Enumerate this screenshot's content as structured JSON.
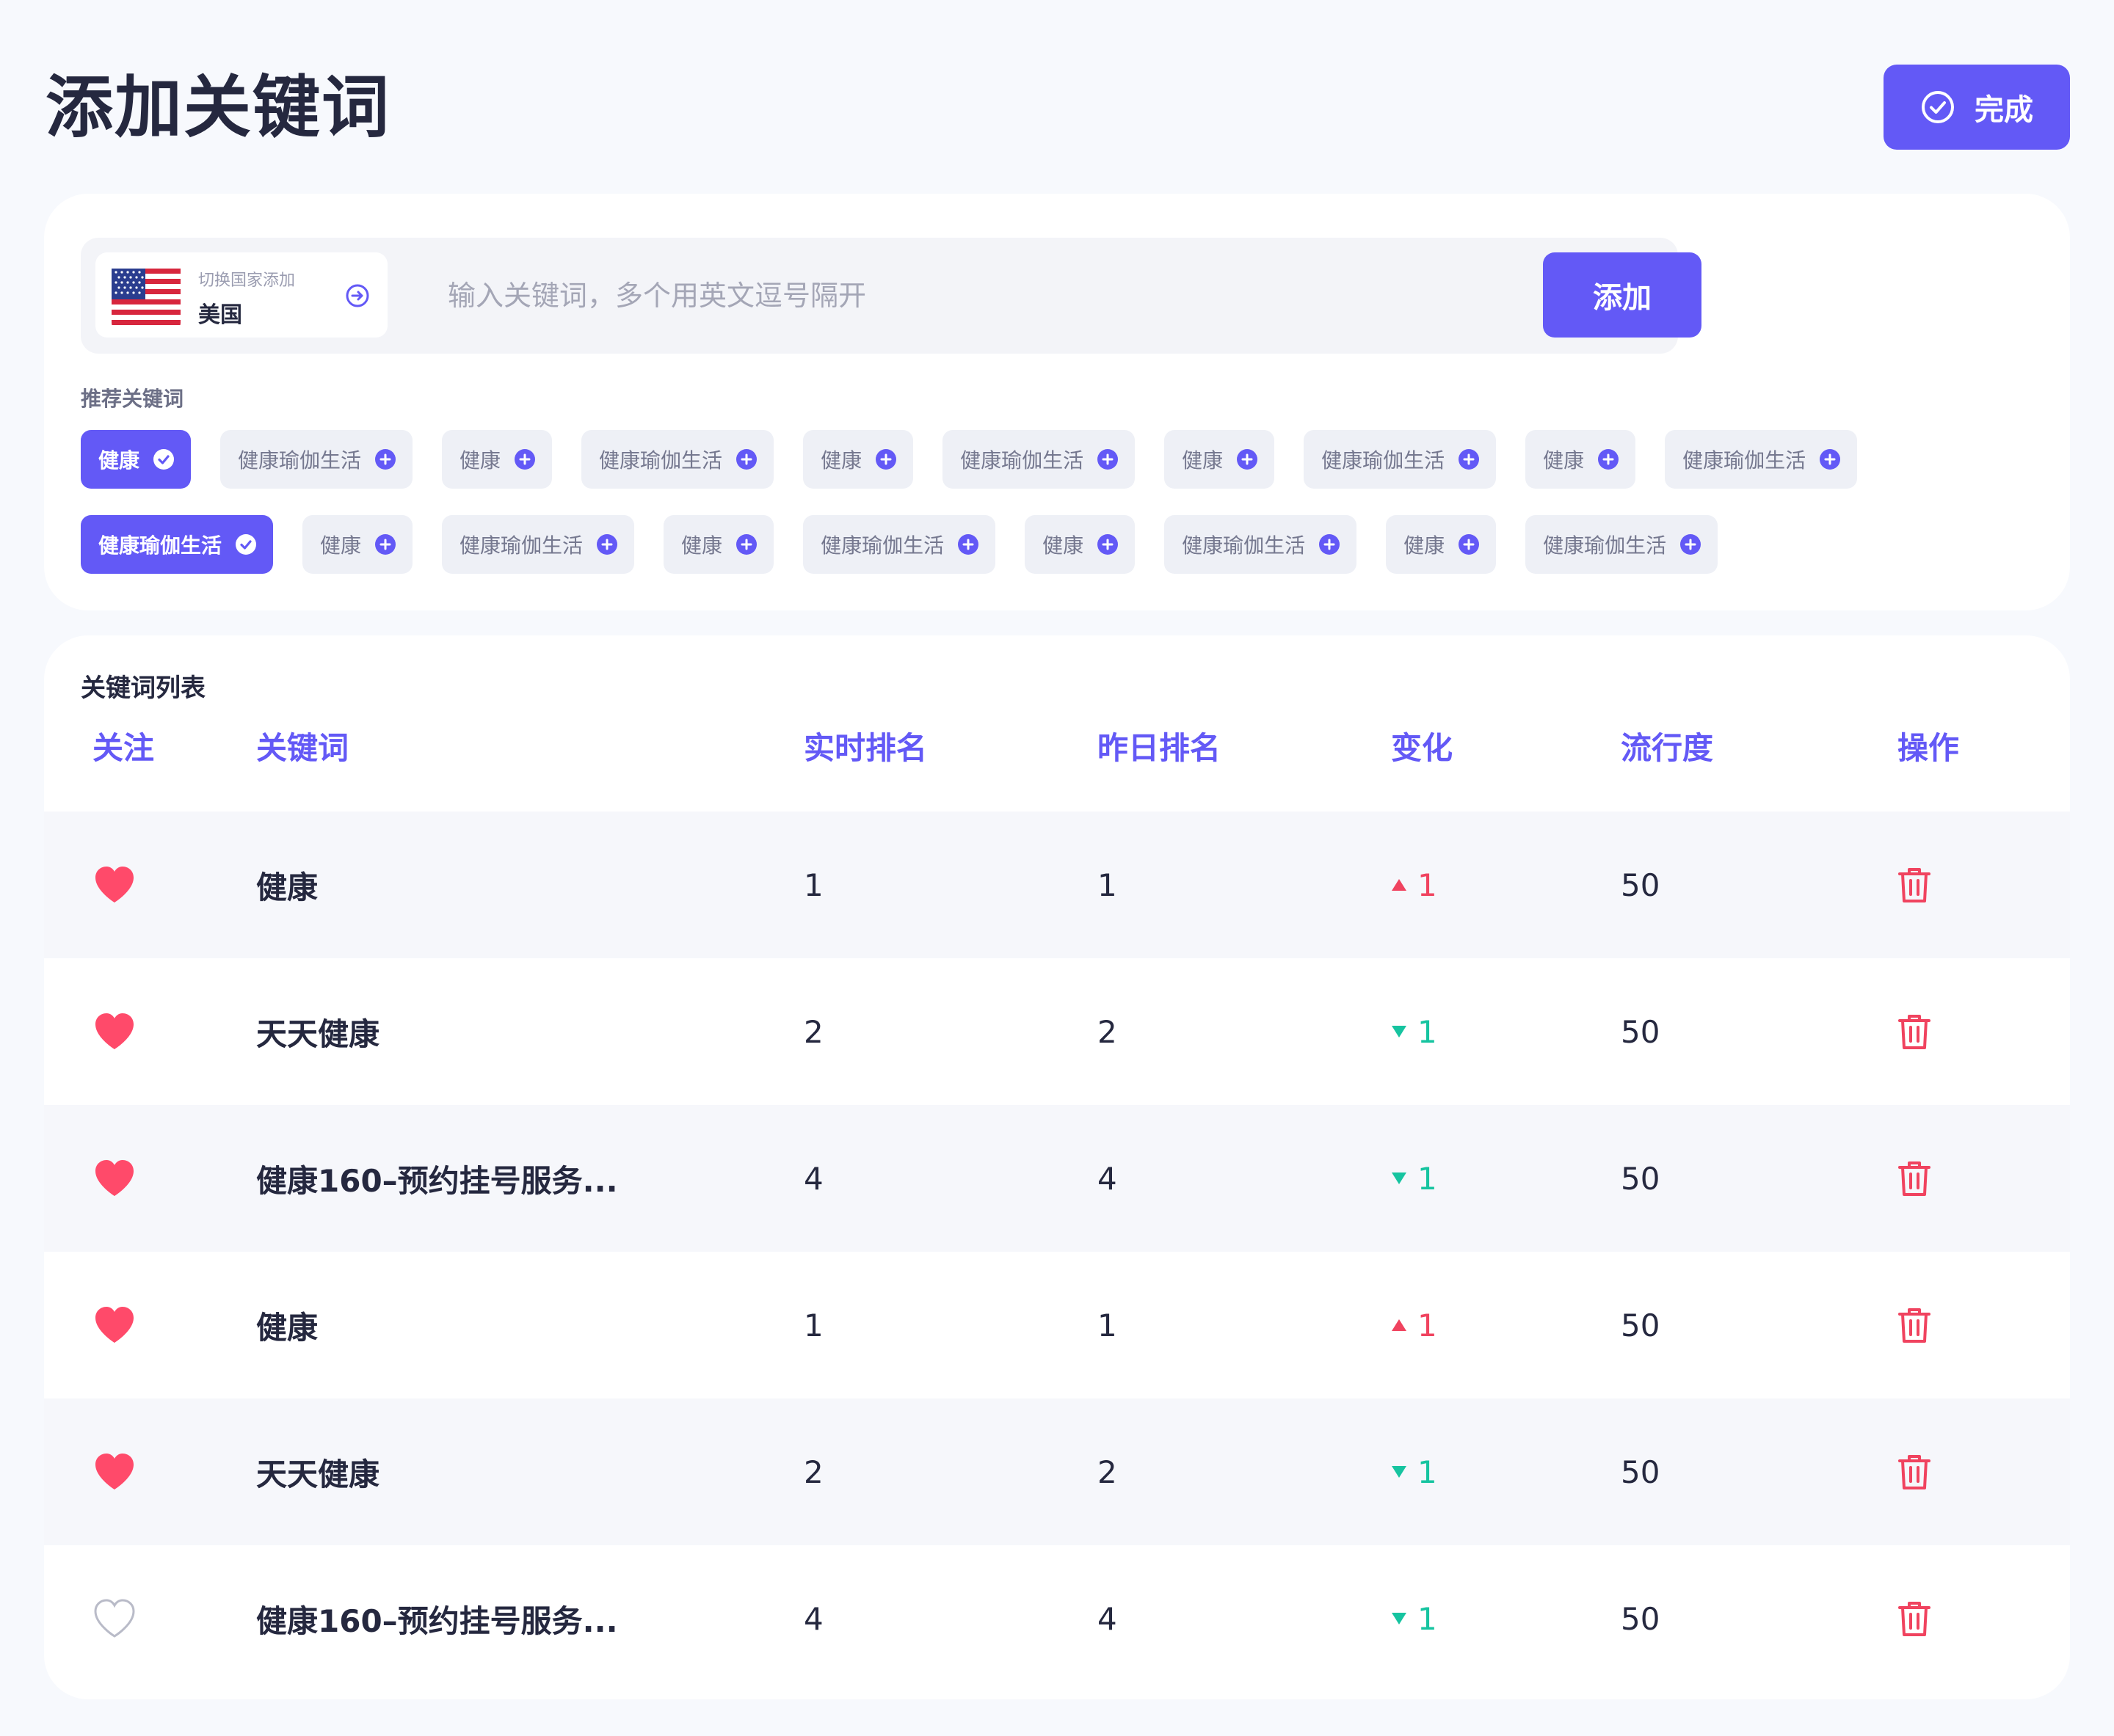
{
  "header": {
    "title": "添加关键词",
    "done_label": "完成"
  },
  "search": {
    "country_label": "切换国家添加",
    "country_name": "美国",
    "placeholder": "输入关键词，多个用英文逗号隔开",
    "add_label": "添加"
  },
  "recommend": {
    "label": "推荐关键词",
    "row1": [
      {
        "text": "健康",
        "active": true
      },
      {
        "text": "健康瑜伽生活",
        "active": false
      },
      {
        "text": "健康",
        "active": false
      },
      {
        "text": "健康瑜伽生活",
        "active": false
      },
      {
        "text": "健康",
        "active": false
      },
      {
        "text": "健康瑜伽生活",
        "active": false
      },
      {
        "text": "健康",
        "active": false
      },
      {
        "text": "健康瑜伽生活",
        "active": false
      },
      {
        "text": "健康",
        "active": false
      },
      {
        "text": "健康瑜伽生活",
        "active": false
      }
    ],
    "row2": [
      {
        "text": "健康瑜伽生活",
        "active": true
      },
      {
        "text": "健康",
        "active": false
      },
      {
        "text": "健康瑜伽生活",
        "active": false
      },
      {
        "text": "健康",
        "active": false
      },
      {
        "text": "健康瑜伽生活",
        "active": false
      },
      {
        "text": "健康",
        "active": false
      },
      {
        "text": "健康瑜伽生活",
        "active": false
      },
      {
        "text": "健康",
        "active": false
      },
      {
        "text": "健康瑜伽生活",
        "active": false
      }
    ]
  },
  "list": {
    "title": "关键词列表",
    "columns": {
      "follow": "关注",
      "keyword": "关键词",
      "realtime": "实时排名",
      "yesterday": "昨日排名",
      "change": "变化",
      "popularity": "流行度",
      "action": "操作"
    },
    "rows": [
      {
        "followed": true,
        "keyword": "健康",
        "realtime": "1",
        "yesterday": "1",
        "direction": "up",
        "change": "1",
        "popularity": "50"
      },
      {
        "followed": true,
        "keyword": "天天健康",
        "realtime": "2",
        "yesterday": "2",
        "direction": "down",
        "change": "1",
        "popularity": "50"
      },
      {
        "followed": true,
        "keyword": "健康160–预约挂号服务...",
        "realtime": "4",
        "yesterday": "4",
        "direction": "down",
        "change": "1",
        "popularity": "50"
      },
      {
        "followed": true,
        "keyword": "健康",
        "realtime": "1",
        "yesterday": "1",
        "direction": "up",
        "change": "1",
        "popularity": "50"
      },
      {
        "followed": true,
        "keyword": "天天健康",
        "realtime": "2",
        "yesterday": "2",
        "direction": "down",
        "change": "1",
        "popularity": "50"
      },
      {
        "followed": false,
        "keyword": "健康160–预约挂号服务...",
        "realtime": "4",
        "yesterday": "4",
        "direction": "down",
        "change": "1",
        "popularity": "50"
      }
    ]
  },
  "colors": {
    "accent": "#6359f6",
    "up": "#f0435f",
    "down": "#16c4a0",
    "heart": "#ff4a6a",
    "trash": "#f0435f"
  },
  "icons": {
    "done": "check-circle-icon",
    "flag": "us-flag-icon",
    "switch": "arrow-right-circle-icon",
    "chip_active": "check-circle-icon",
    "chip_inactive": "plus-circle-icon",
    "follow": "heart-icon",
    "action": "trash-icon"
  }
}
